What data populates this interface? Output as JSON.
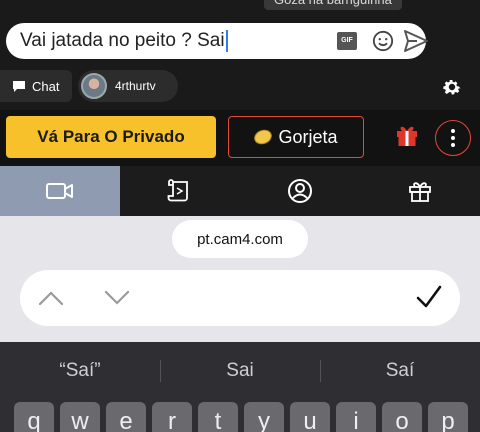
{
  "toast": {
    "text": "Goza na barriguinha"
  },
  "chat_input": {
    "value": "Vai jatada no peito ? Sai",
    "gif_label": "GIF"
  },
  "tabs": {
    "chat_label": "Chat",
    "user_name": "4rthurtv"
  },
  "actions": {
    "private_label": "Vá Para O Privado",
    "tip_label": "Gorjeta"
  },
  "nav": {
    "icons": [
      "video-camera-icon",
      "scroll-icon",
      "profile-icon",
      "gift-icon"
    ],
    "active_index": 0
  },
  "browser": {
    "url": "pt.cam4.com"
  },
  "keyboard": {
    "suggestions": [
      "“Saí”",
      "Sai",
      "Saí"
    ],
    "keys": [
      "q",
      "w",
      "e",
      "r",
      "t",
      "y",
      "u",
      "i",
      "o",
      "p"
    ]
  },
  "colors": {
    "accent_yellow": "#f6c12b",
    "accent_red": "#e04a3a",
    "caret_blue": "#2f7cf6"
  }
}
